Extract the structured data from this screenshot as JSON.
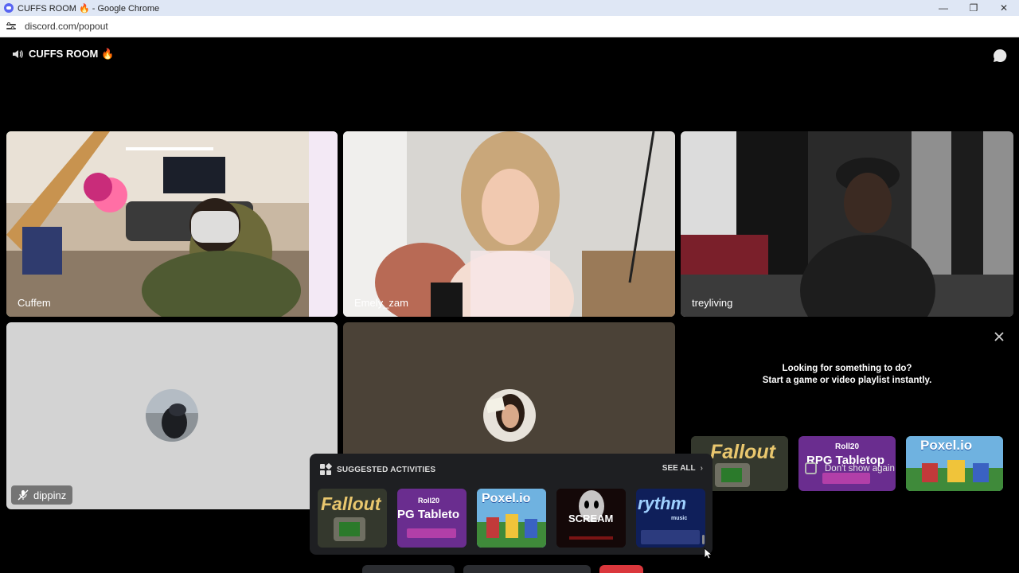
{
  "browser": {
    "window_title": "CUFFS ROOM 🔥 - Google Chrome",
    "url": "discord.com/popout",
    "controls": {
      "minimize": "—",
      "restore": "❐",
      "close": "✕"
    }
  },
  "room": {
    "name": "CUFFS ROOM 🔥"
  },
  "participants": [
    {
      "name": "Cuffem",
      "speaking": true,
      "video": true
    },
    {
      "name": "Emely_zam",
      "speaking": false,
      "video": true
    },
    {
      "name": "treyliving",
      "speaking": false,
      "video": true
    },
    {
      "name": "dippinz",
      "muted": true,
      "video": false,
      "tile_color": "#d3d3d3"
    },
    {
      "name": "",
      "video": false,
      "tile_color": "#4b4237"
    }
  ],
  "activity_panel": {
    "line1": "Looking for something to do?",
    "line2": "Start a game or video playlist instantly.",
    "cards": [
      {
        "title": "Fallout",
        "icon": "fallout-icon"
      },
      {
        "brand": "Roll20",
        "title": "RPG Tabletop",
        "icon": "roll20-icon"
      },
      {
        "title": "Poxel.io",
        "icon": "poxel-icon"
      }
    ],
    "dont_show_label": "Don't show again"
  },
  "suggested": {
    "header": "SUGGESTED ACTIVITIES",
    "see_all": "SEE ALL",
    "items": [
      {
        "title": "Fallout"
      },
      {
        "brand": "Roll20",
        "title": "PG Tableto"
      },
      {
        "title": "Poxel.io"
      },
      {
        "title": "SCREAM"
      },
      {
        "title": "rythm",
        "subtitle": "music"
      }
    ]
  },
  "colors": {
    "speaking_ring": "#23a55a",
    "blurple": "#5865f2",
    "disconnect_red": "#da373c"
  }
}
